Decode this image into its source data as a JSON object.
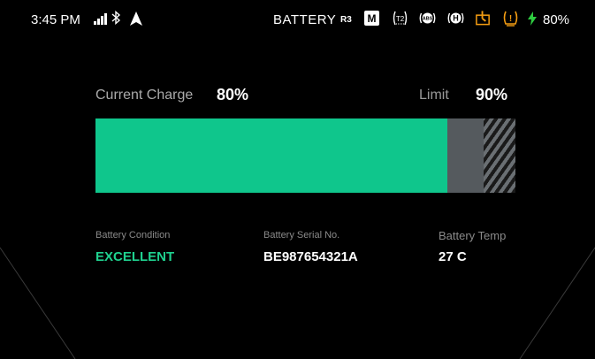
{
  "status_bar": {
    "time": "3:45 PM",
    "title": "BATTERY",
    "ride_mode_code": "R3",
    "gear_mode": "M",
    "indicators": [
      {
        "name": "traction-control-icon",
        "text": "T2",
        "color": "#ffffff"
      },
      {
        "name": "abs-icon",
        "text": "ABS",
        "color": "#ffffff"
      },
      {
        "name": "hill-hold-icon",
        "text": "H",
        "color": "#ffffff"
      },
      {
        "name": "kickstand-warning-icon",
        "color": "#f39c12"
      },
      {
        "name": "tire-pressure-warning-icon",
        "text": "!",
        "color": "#f39c12"
      }
    ],
    "battery_percent": "80%"
  },
  "charge": {
    "current_label": "Current Charge",
    "current_value": "80%",
    "current_fraction": 0.8,
    "limit_label": "Limit",
    "limit_value": "90%",
    "limit_fraction": 0.9
  },
  "info": {
    "condition_label": "Battery Condition",
    "condition_value": "EXCELLENT",
    "serial_label": "Battery Serial No.",
    "serial_value": "BE987654321A",
    "temp_label": "Battery Temp",
    "temp_value": "27 C"
  },
  "colors": {
    "charge_fill": "#0fc68c",
    "condition_good": "#1fd18f",
    "warning": "#f39c12",
    "charging": "#2ecc40"
  }
}
